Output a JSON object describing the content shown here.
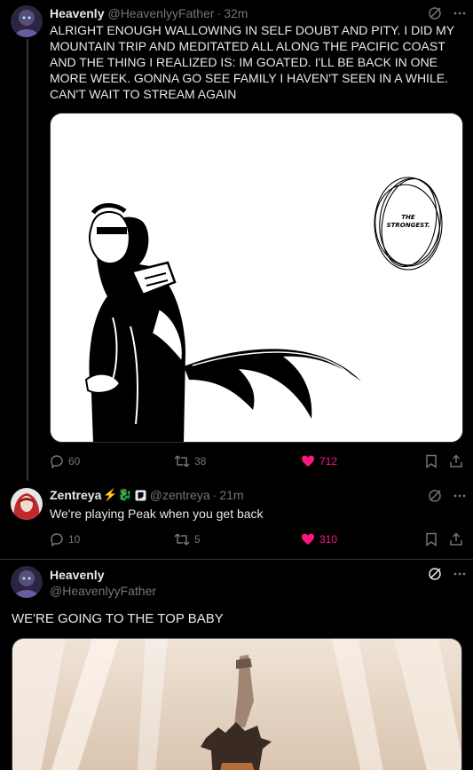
{
  "colors": {
    "background": "#000000",
    "text": "#e7e9ea",
    "muted": "#71767b",
    "like": "#f91880",
    "border": "#2f3336"
  },
  "posts": [
    {
      "name": "Heavenly",
      "handle": "@HeavenlyyFather",
      "dot": "·",
      "time": "32m",
      "text": "ALRIGHT ENOUGH WALLOWING IN SELF DOUBT AND PITY.  I DID MY MOUNTAIN TRIP AND MEDITATED ALL ALONG THE PACIFIC COAST AND THE THING I REALIZED IS: IM GOATED.  I'LL BE BACK IN ONE MORE WEEK. GONNA GO SEE FAMILY I HAVEN'T SEEN IN A WHILE. CAN'T WAIT TO STREAM AGAIN",
      "image": {
        "description_icon": "manga-panel",
        "speech_text": "THE STRONGEST."
      },
      "stats": {
        "replies": "60",
        "reposts": "38",
        "likes": "712"
      }
    },
    {
      "name": "Zentreya",
      "name_emoji": "⚡🐉",
      "handle": "@zentreya",
      "dot": "·",
      "time": "21m",
      "text": "We're playing Peak when you get back",
      "stats": {
        "replies": "10",
        "reposts": "5",
        "likes": "310"
      }
    },
    {
      "name": "Heavenly",
      "handle": "@HeavenlyyFather",
      "text": "WE'RE GOING TO THE TOP BABY",
      "image": {
        "description_icon": "anime-still"
      }
    }
  ]
}
